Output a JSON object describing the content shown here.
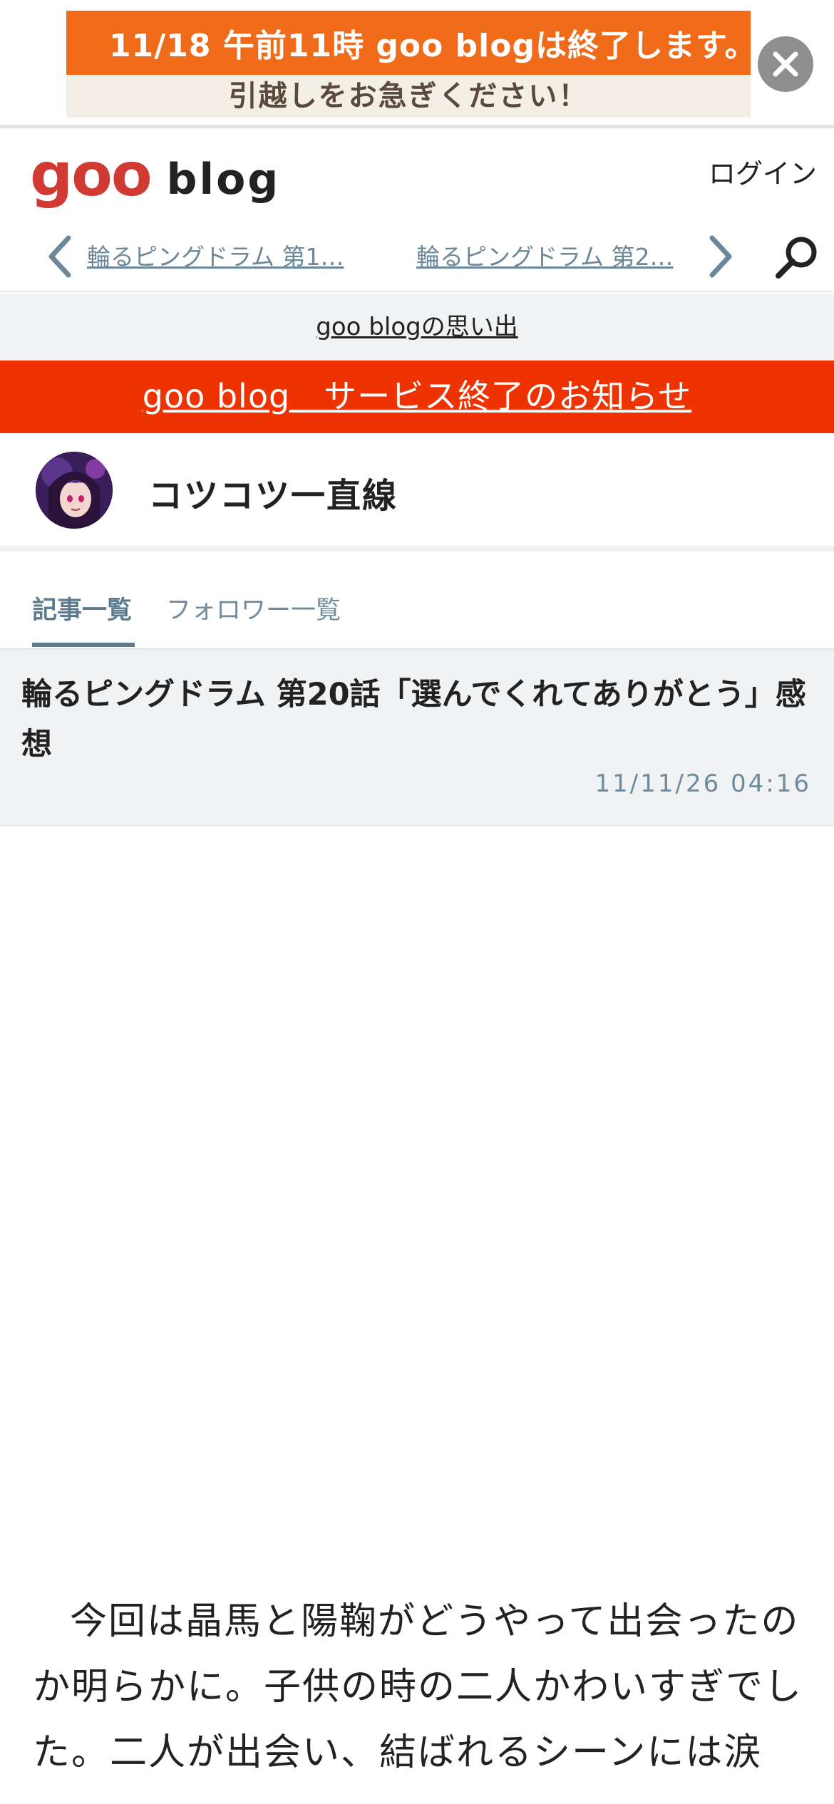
{
  "ad": {
    "line1": "11/18 午前11時 goo blogは終了します。",
    "line2": "引越しをお急ぎください！",
    "close_icon": "close-icon"
  },
  "header": {
    "logo_goo": "goo",
    "logo_blog": "blog",
    "login": "ログイン"
  },
  "nav": {
    "prev_title": "輪るピングドラム 第1…",
    "next_title": "輪るピングドラム 第2…",
    "prev_icon": "chevron-left-icon",
    "next_icon": "chevron-right-icon",
    "search_icon": "search-icon"
  },
  "memories_link": "goo blogの思い出",
  "service_notice": "goo blog　サービス終了のお知らせ",
  "blog": {
    "name": "コツコツ一直線"
  },
  "tabs": [
    {
      "label": "記事一覧",
      "active": true
    },
    {
      "label": "フォロワー一覧",
      "active": false
    }
  ],
  "article": {
    "title": "輪るピングドラム 第20話「選んでくれてありがとう」感想",
    "date": "11/11/26 04:16",
    "body": "今回は晶馬と陽鞠がどうやって出会ったのか明らかに。子供の時の二人かわいすぎでした。二人が出会い、結ばれるシーンには涙"
  },
  "colors": {
    "ad_orange": "#ef6b1a",
    "brand_red": "#d03a32",
    "notice_red": "#ee3300",
    "accent_slate": "#5d7b8d"
  }
}
